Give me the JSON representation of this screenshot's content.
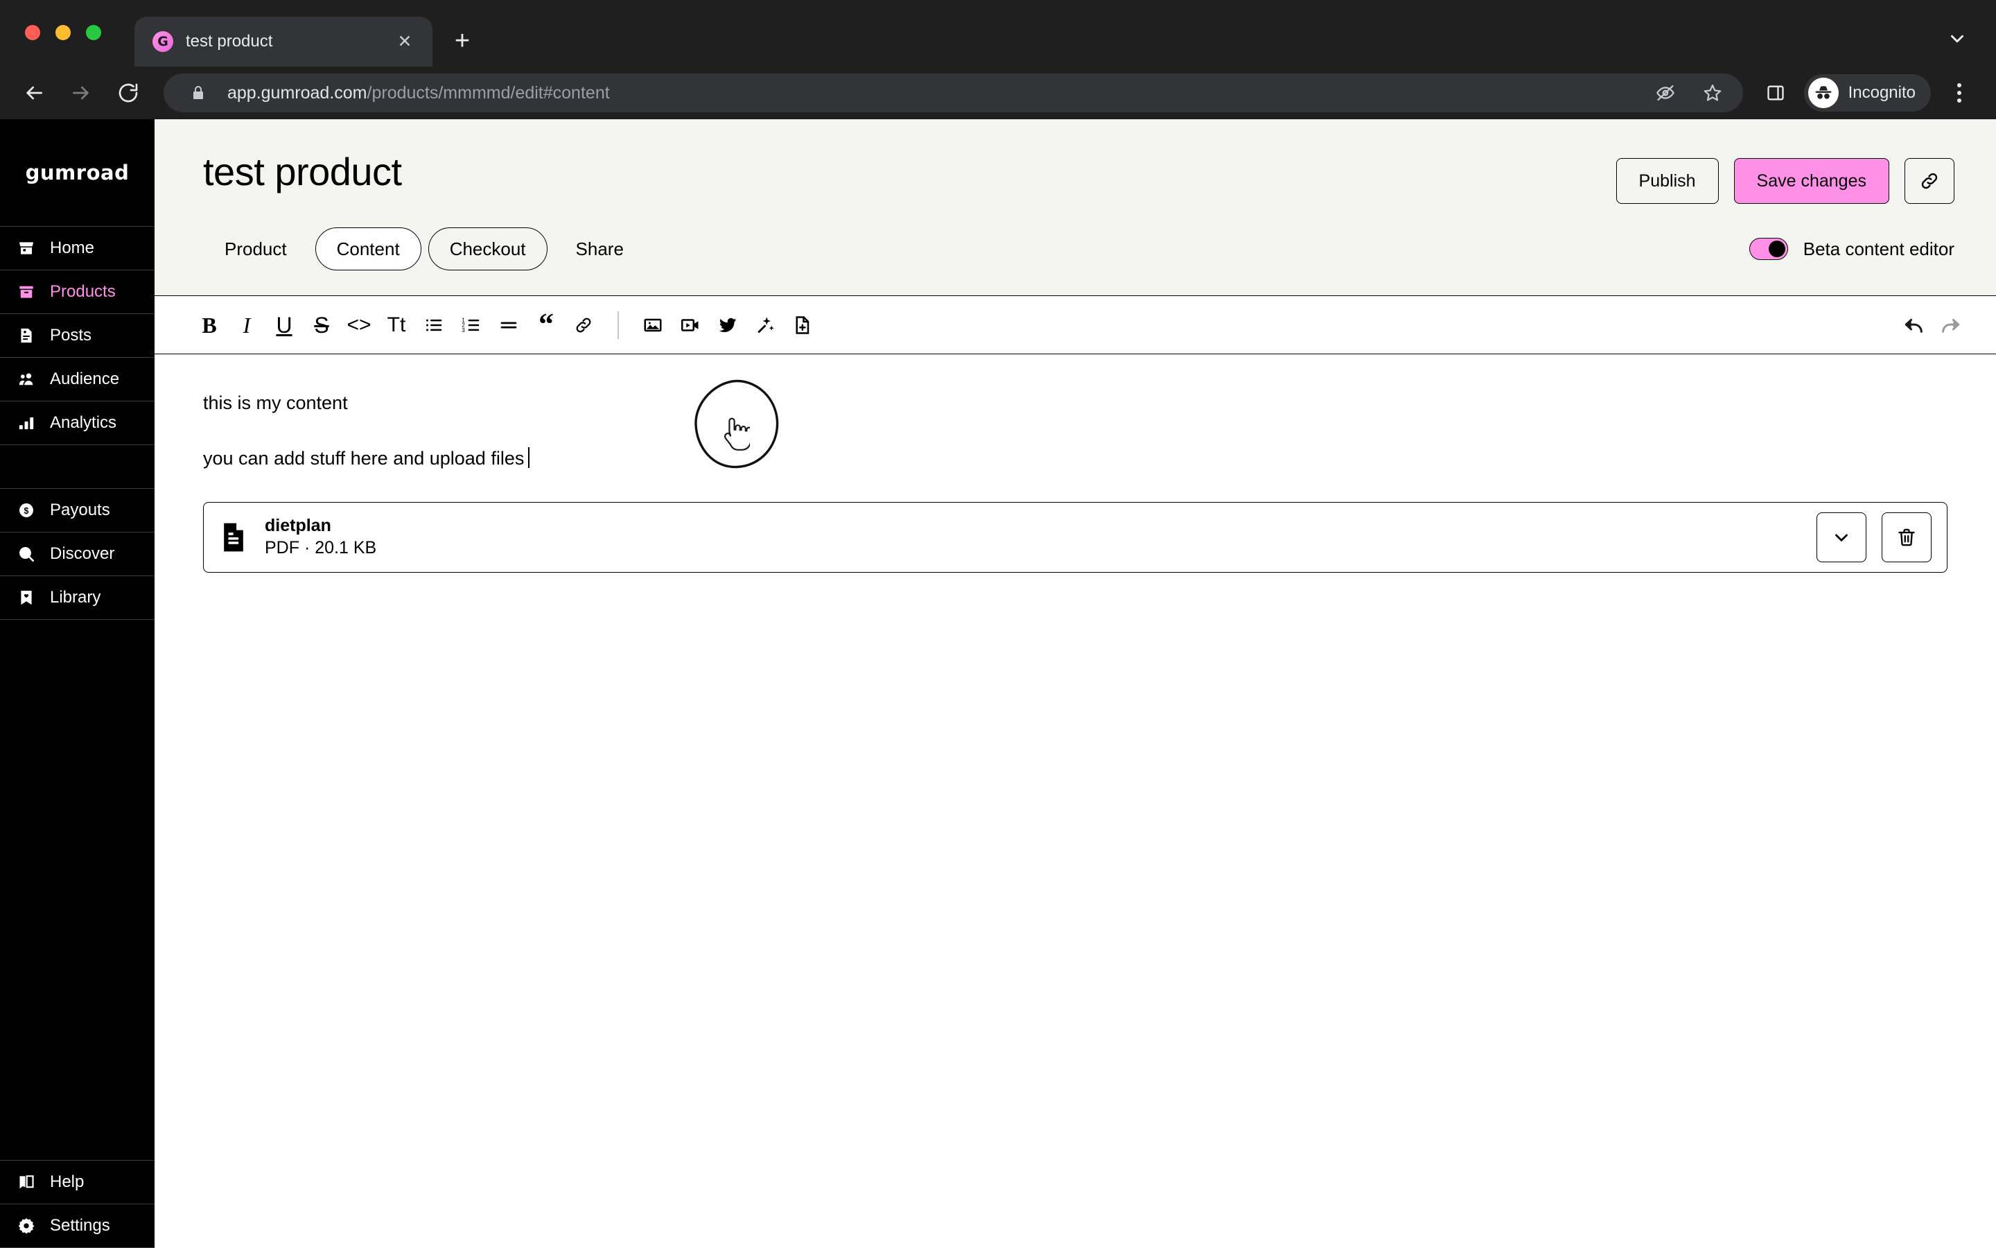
{
  "browser": {
    "traffic_lights": [
      "close",
      "minimize",
      "maximize"
    ],
    "tab": {
      "title": "test product",
      "favicon_letter": "G",
      "close_label": "✕"
    },
    "new_tab_label": "+",
    "tabstrip_overflow_icon": "chevron-down-icon",
    "toolbar": {
      "back_icon": "back-arrow-icon",
      "forward_icon": "forward-arrow-icon",
      "reload_icon": "reload-icon",
      "lock_icon": "lock-icon",
      "url_host": "app.gumroad.com",
      "url_path": "/products/mmmmd/edit#content",
      "url_full": "app.gumroad.com/products/mmmmd/edit#content",
      "tracking_protection_icon": "eye-slash-icon",
      "bookmark_icon": "star-icon",
      "side_panel_icon": "side-panel-icon",
      "profile_label": "Incognito",
      "profile_icon": "incognito-icon",
      "menu_icon": "kebab-menu-icon"
    }
  },
  "sidebar": {
    "brand": "GUMROAD",
    "items": [
      {
        "label": "Home",
        "icon": "storefront-icon",
        "active": false
      },
      {
        "label": "Products",
        "icon": "box-icon",
        "active": true
      },
      {
        "label": "Posts",
        "icon": "document-icon",
        "active": false
      },
      {
        "label": "Audience",
        "icon": "people-icon",
        "active": false
      },
      {
        "label": "Analytics",
        "icon": "bar-chart-icon",
        "active": false
      },
      {
        "label": "Payouts",
        "icon": "dollar-coin-icon",
        "active": false
      },
      {
        "label": "Discover",
        "icon": "search-icon",
        "active": false
      },
      {
        "label": "Library",
        "icon": "bookmark-heart-icon",
        "active": false
      },
      {
        "label": "Help",
        "icon": "book-icon",
        "active": false
      },
      {
        "label": "Settings",
        "icon": "gear-icon",
        "active": false
      }
    ]
  },
  "page": {
    "title": "test product",
    "actions": {
      "publish_label": "Publish",
      "save_label": "Save changes",
      "link_icon": "link-icon"
    },
    "tabs": [
      {
        "label": "Product",
        "state": "plain"
      },
      {
        "label": "Content",
        "state": "active"
      },
      {
        "label": "Checkout",
        "state": "bordered"
      },
      {
        "label": "Share",
        "state": "plain"
      }
    ],
    "beta_toggle": {
      "label": "Beta content editor",
      "on": true,
      "accent_color": "#ff90e8"
    }
  },
  "editor": {
    "toolbar_primary": [
      {
        "name": "bold-icon",
        "glyph": "B"
      },
      {
        "name": "italic-icon",
        "glyph": "I"
      },
      {
        "name": "underline-icon",
        "glyph": "U"
      },
      {
        "name": "strikethrough-icon",
        "glyph": "S"
      },
      {
        "name": "code-icon",
        "glyph": "<>"
      },
      {
        "name": "text-size-icon",
        "glyph": "Tt"
      },
      {
        "name": "bulleted-list-icon",
        "glyph": ""
      },
      {
        "name": "numbered-list-icon",
        "glyph": ""
      },
      {
        "name": "horizontal-rule-icon",
        "glyph": ""
      },
      {
        "name": "blockquote-icon",
        "glyph": "“"
      },
      {
        "name": "link-icon",
        "glyph": ""
      }
    ],
    "toolbar_secondary": [
      {
        "name": "image-icon"
      },
      {
        "name": "video-icon"
      },
      {
        "name": "twitter-icon"
      },
      {
        "name": "magic-wand-icon"
      },
      {
        "name": "add-file-icon"
      }
    ],
    "undo_icon": "undo-icon",
    "redo_icon": "redo-icon",
    "redo_disabled": true,
    "paragraphs": [
      "this is my content",
      "you can add stuff here and upload files"
    ],
    "caret_after_paragraph_index": 1,
    "file": {
      "icon": "pdf-file-icon",
      "name": "dietplan",
      "meta": "PDF · 20.1 KB",
      "expand_icon": "chevron-down-icon",
      "delete_icon": "trash-icon"
    }
  },
  "annotation": {
    "shape": "hand-drawn-ellipse",
    "target": "Checkout",
    "cursor": "pointer-hand-cursor"
  },
  "colors": {
    "brand_pink": "#ff90e8",
    "page_bg": "#f4f4f0",
    "sidebar_bg": "#000000",
    "chrome_bg": "#1f1f1f",
    "content_bg": "#ffffff"
  }
}
